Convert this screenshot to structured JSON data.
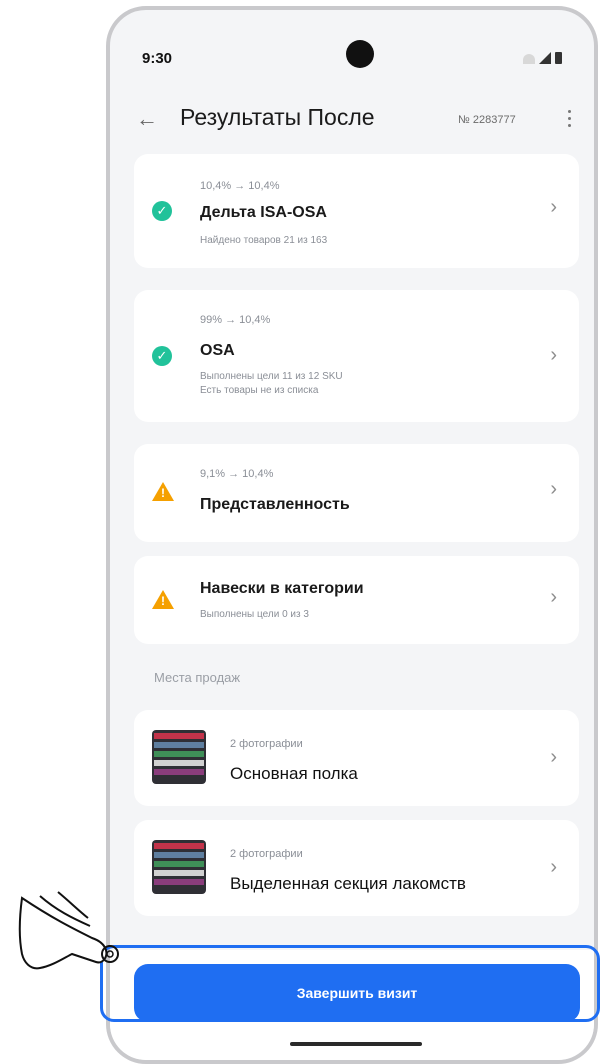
{
  "status_bar": {
    "time": "9:30"
  },
  "header": {
    "title": "Результаты После",
    "order_number": "№ 2283777"
  },
  "results": [
    {
      "trend": "10,4%  →  10,4%",
      "name": "Дельта ISA-OSA",
      "desc": "Найдено товаров 21 из 163",
      "status": "ok"
    },
    {
      "trend": "99%  →  10,4%",
      "name": "OSA",
      "desc": "Выполнены цели 11 из 12 SKU\nЕсть товары не из списка",
      "status": "ok"
    },
    {
      "trend": "9,1%  →  10,4%",
      "name": "Представленность",
      "desc": "",
      "status": "warning"
    },
    {
      "trend": "",
      "name": "Навески в категории",
      "desc": "Выполнены цели 0 из 3",
      "status": "warning"
    }
  ],
  "places": {
    "section_label": "Места продаж",
    "items": [
      {
        "photos": "2 фотографии",
        "name": "Основная полка"
      },
      {
        "photos": "2 фотографии",
        "name": "Выделенная секция лакомств"
      }
    ]
  },
  "cta": {
    "label": "Завершить визит"
  },
  "colors": {
    "accent": "#1f6ef2",
    "ok": "#21c29a",
    "warning": "#f5a000"
  }
}
